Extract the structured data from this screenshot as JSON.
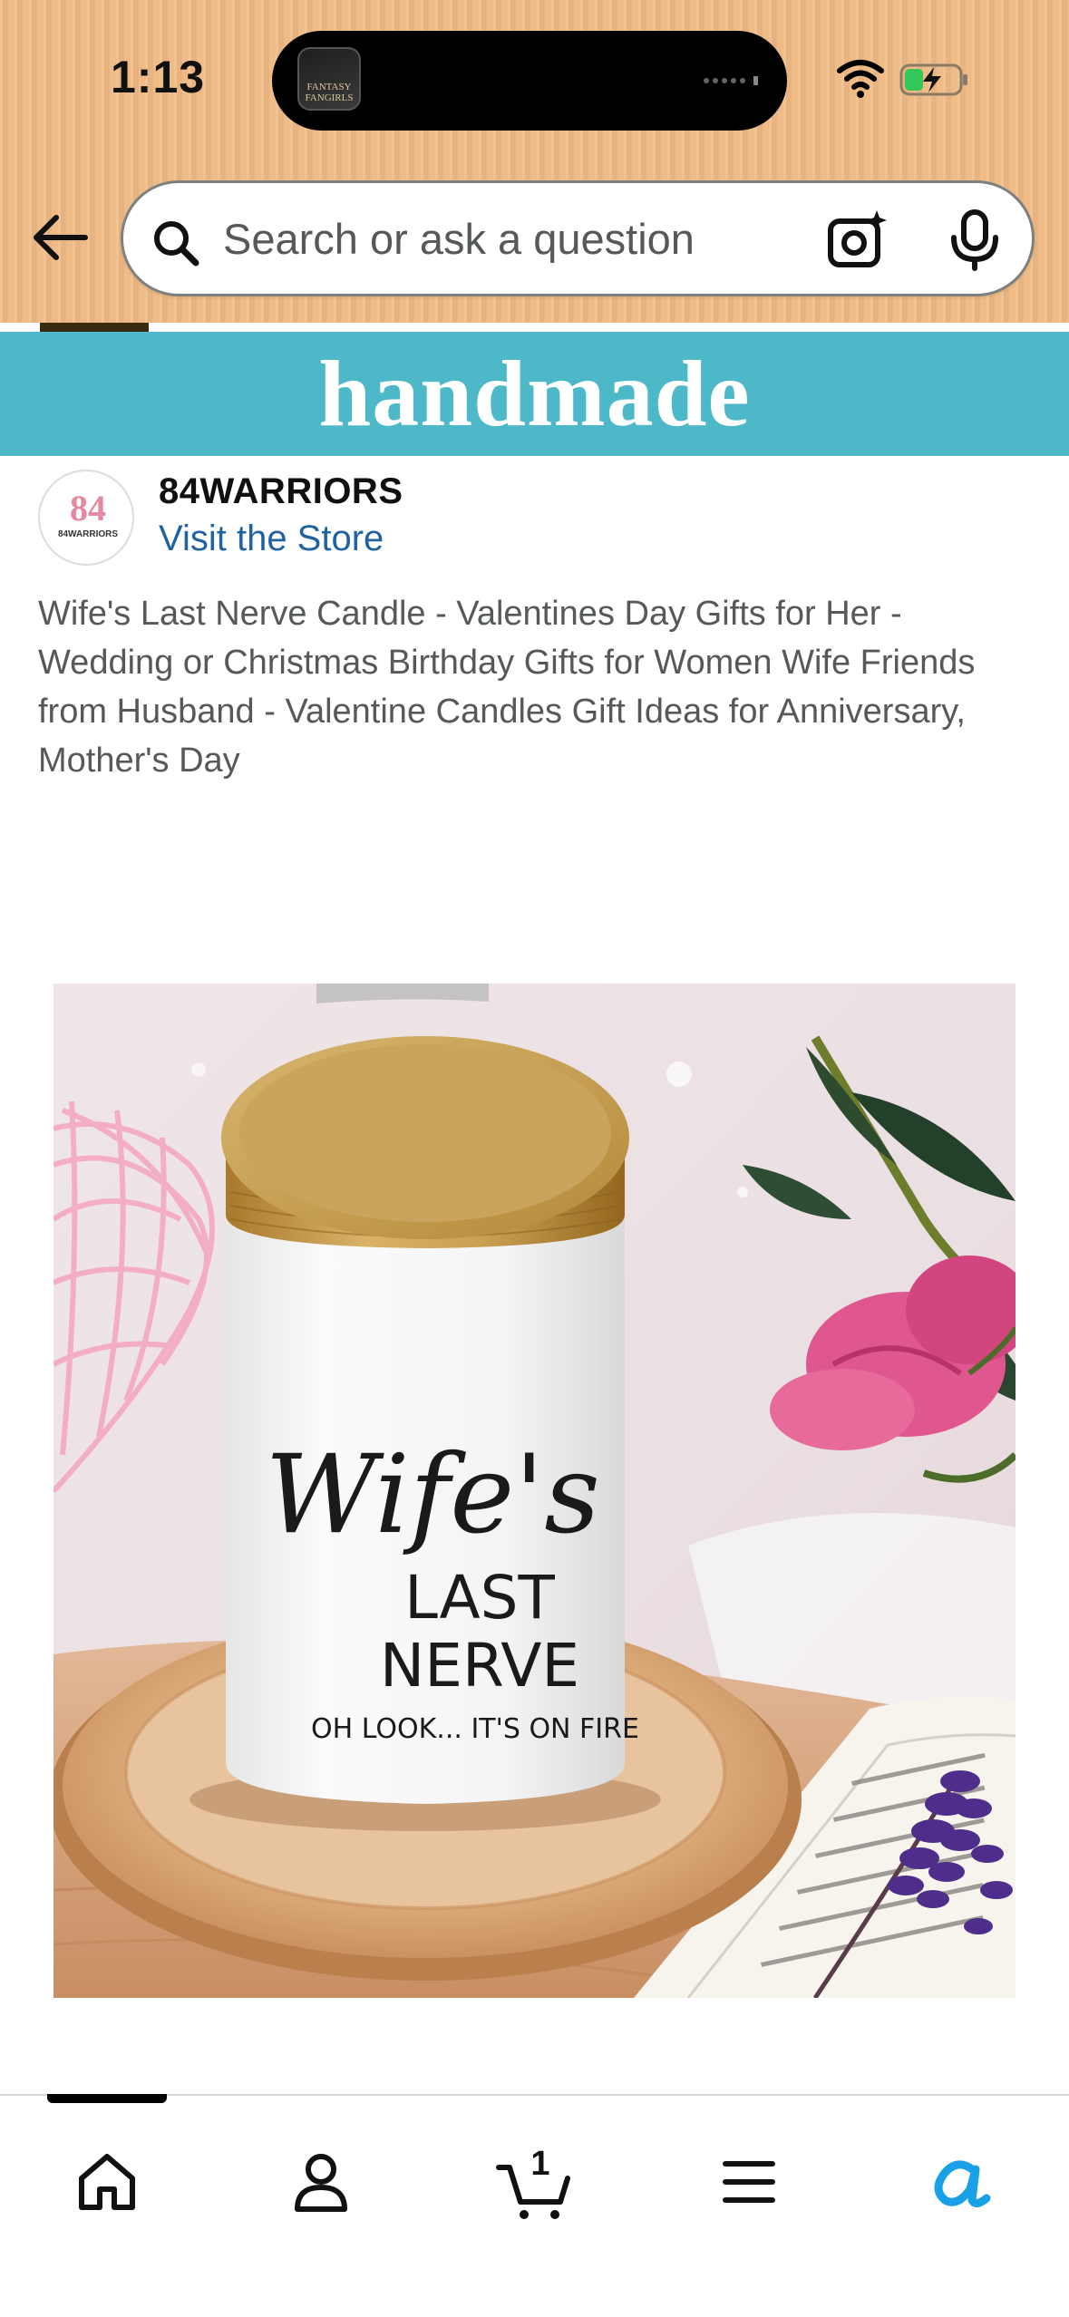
{
  "status_bar": {
    "time": "1:13",
    "island_app_label": "FANTASY FANGIRLS"
  },
  "search": {
    "placeholder": "Search or ask a question"
  },
  "banner": {
    "text": "handmade",
    "color": "#4db9c8"
  },
  "store": {
    "logo_text": "84",
    "logo_subtext": "84WARRIORS",
    "name": "84WARRIORS",
    "visit_label": "Visit the Store"
  },
  "product": {
    "title": "Wife's Last Nerve Candle - Valentines Day Gifts for Her - Wedding or Christmas Birthday Gifts for Women Wife Friends from Husband - Valentine Candles Gift Ideas for Anniversary, Mother's Day",
    "image_text": {
      "line1": "Wife's",
      "line2": "LAST",
      "line3": "NERVE",
      "line4": "OH LOOK... IT'S ON FIRE"
    }
  },
  "bottom_nav": {
    "cart_count": "1",
    "items": [
      "home-icon",
      "profile-icon",
      "cart-icon",
      "menu-icon",
      "rufus-icon"
    ]
  },
  "colors": {
    "header_bg": "#efbb86",
    "link": "#2162a1",
    "rufus_accent": "#1aa0e6"
  }
}
